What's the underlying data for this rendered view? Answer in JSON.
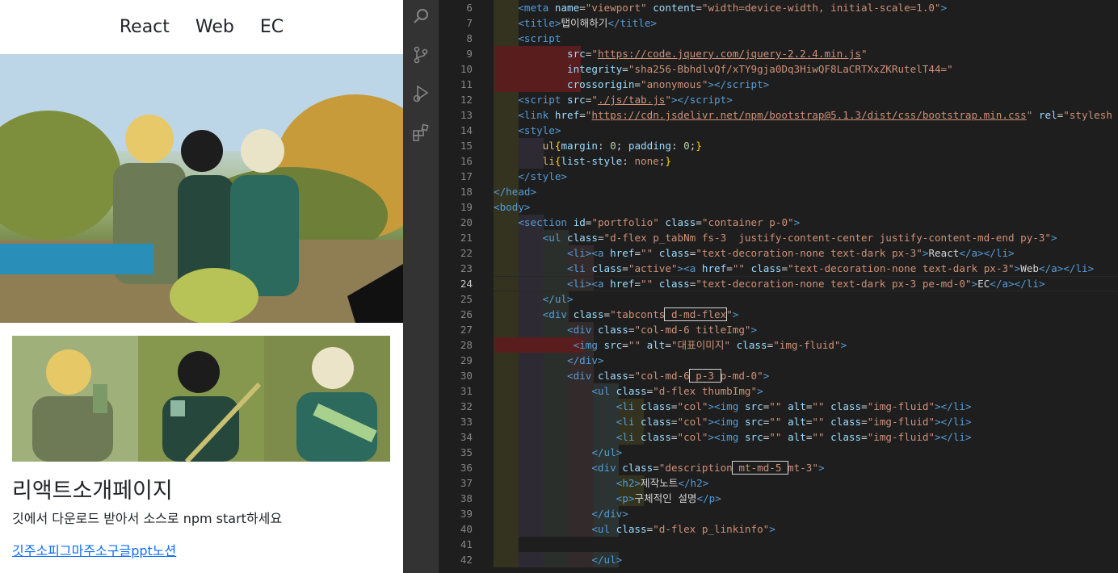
{
  "preview": {
    "tabs": [
      "React",
      "Web",
      "EC"
    ],
    "title": "리액트소개페이지",
    "text": "깃에서 다운로드 받아서 소스로 npm start하세요",
    "links": "깃주소피그마주소구글ppt노션"
  },
  "activity_icons": [
    "search-icon",
    "source-control-icon",
    "run-debug-icon",
    "extensions-icon"
  ],
  "editor": {
    "lines": [
      {
        "n": "6",
        "html": "<span class='t'>&lt;meta</span> <span class='a'>name</span>=<span class='s'>\"viewport\"</span> <span class='a'>content</span>=<span class='s'>\"width=device-width, initial-scale=1.0\"</span><span class='t'>&gt;</span>"
      },
      {
        "n": "7",
        "html": "<span class='t'>&lt;title&gt;</span>탭이해하기<span class='t'>&lt;/title&gt;</span>"
      },
      {
        "n": "8",
        "html": "<span class='t'>&lt;script</span>"
      },
      {
        "n": "9",
        "html": "        <span class='a'>src</span>=<span class='s'>\"</span><span class='u'>https://code.jquery.com/jquery-2.2.4.min.js</span><span class='s'>\"</span>"
      },
      {
        "n": "10",
        "html": "        <span class='a'>integrity</span>=<span class='s'>\"sha256-BbhdlvQf/xTY9gja0Dq3HiwQF8LaCRTXxZKRutelT44=\"</span>"
      },
      {
        "n": "11",
        "html": "        <span class='a'>crossorigin</span>=<span class='s'>\"anonymous\"</span><span class='t'>&gt;&lt;/script&gt;</span>"
      },
      {
        "n": "12",
        "html": "<span class='t'>&lt;script</span> <span class='a'>src</span>=<span class='s'>\"</span><span class='u'>./js/tab.js</span><span class='s'>\"</span><span class='t'>&gt;&lt;/script&gt;</span>"
      },
      {
        "n": "13",
        "html": "<span class='t'>&lt;link</span> <span class='a'>href</span>=<span class='s'>\"</span><span class='u'>https://cdn.jsdelivr.net/npm/bootstrap@5.1.3/dist/css/bootstrap.min.css</span><span class='s'>\"</span> <span class='a'>rel</span>=<span class='s'>\"stylesh</span>"
      },
      {
        "n": "14",
        "html": "<span class='t'>&lt;style&gt;</span>"
      },
      {
        "n": "15",
        "html": "    <span class='y'>ul</span><span class='b'>{</span><span class='k'>margin</span>: <span style='color:#b5cea8'>0</span>; <span class='k'>padding</span>: <span style='color:#b5cea8'>0</span>;<span class='b'>}</span>"
      },
      {
        "n": "16",
        "html": "    <span class='y'>li</span><span class='b'>{</span><span class='k'>list-style</span>: <span class='s'>none</span>;<span class='b'>}</span>"
      },
      {
        "n": "17",
        "html": "<span class='t'>&lt;/style&gt;</span>"
      },
      {
        "n": "18",
        "html": "<span class='t'>&lt;/head&gt;</span>"
      },
      {
        "n": "19",
        "html": "<span class='t'>&lt;body&gt;</span>"
      },
      {
        "n": "20",
        "html": "    <span class='t'>&lt;section</span> <span class='a'>id</span>=<span class='s'>\"portfolio\"</span> <span class='a'>class</span>=<span class='s'>\"container p-0\"</span><span class='t'>&gt;</span>"
      },
      {
        "n": "21",
        "html": "        <span class='t'>&lt;ul</span> <span class='a'>class</span>=<span class='s'>\"d-flex p_tabNm fs-3  justify-content-center justify-content-md-end py-3\"</span><span class='t'>&gt;</span>"
      },
      {
        "n": "22",
        "html": "            <span class='t'>&lt;li&gt;&lt;a</span> <span class='a'>href</span>=<span class='s'>\"\"</span> <span class='a'>class</span>=<span class='s'>\"text-decoration-none text-dark px-3\"</span><span class='t'>&gt;</span>React<span class='t'>&lt;/a&gt;&lt;/li&gt;</span>"
      },
      {
        "n": "23",
        "html": "            <span class='t'>&lt;li</span> <span class='a'>class</span>=<span class='s'>\"active\"</span><span class='t'>&gt;&lt;a</span> <span class='a'>href</span>=<span class='s'>\"\"</span> <span class='a'>class</span>=<span class='s'>\"text-decoration-none text-dark px-3\"</span><span class='t'>&gt;</span>Web<span class='t'>&lt;/a&gt;&lt;/li&gt;</span>"
      },
      {
        "n": "24",
        "html": "            <span class='t'>&lt;li&gt;&lt;a</span> <span class='a'>href</span>=<span class='s'>\"\"</span> <span class='a'>class</span>=<span class='s'>\"text-decoration-none text-dark px-3 pe-md-0\"</span><span class='t'>&gt;</span>EC<span class='t'>&lt;/a&gt;&lt;/li&gt;</span>"
      },
      {
        "n": "25",
        "html": "        <span class='t'>&lt;/ul&gt;</span>"
      },
      {
        "n": "26",
        "html": "        <span class='t'>&lt;div</span> <span class='a'>class</span>=<span class='s'>\"tabconts<span class='box'> d-md-flex</span>\"</span><span class='t'>&gt;</span>"
      },
      {
        "n": "27",
        "html": "            <span class='t'>&lt;div</span> <span class='a'>class</span>=<span class='s'>\"col-md-6 titleImg\"</span><span class='t'>&gt;</span>"
      },
      {
        "n": "28",
        "html": "             <span class='t'>&lt;img</span> <span class='a'>src</span>=<span class='s'>\"\"</span> <span class='a'>alt</span>=<span class='s'>\"대표이미지\"</span> <span class='a'>class</span>=<span class='s'>\"img-fluid\"</span><span class='t'>&gt;</span>"
      },
      {
        "n": "29",
        "html": "            <span class='t'>&lt;/div&gt;</span>"
      },
      {
        "n": "30",
        "html": "            <span class='t'>&lt;div</span> <span class='a'>class</span>=<span class='s'>\"col-md-6<span class='box'> p-3 </span>p-md-0\"</span><span class='t'>&gt;</span>"
      },
      {
        "n": "31",
        "html": "                <span class='t'>&lt;ul</span> <span class='a'>class</span>=<span class='s'>\"d-flex thumbImg\"</span><span class='t'>&gt;</span>"
      },
      {
        "n": "32",
        "html": "                    <span class='t'>&lt;li</span> <span class='a'>class</span>=<span class='s'>\"col\"</span><span class='t'>&gt;&lt;img</span> <span class='a'>src</span>=<span class='s'>\"\"</span> <span class='a'>alt</span>=<span class='s'>\"\"</span> <span class='a'>class</span>=<span class='s'>\"img-fluid\"</span><span class='t'>&gt;&lt;/li&gt;</span>"
      },
      {
        "n": "33",
        "html": "                    <span class='t'>&lt;li</span> <span class='a'>class</span>=<span class='s'>\"col\"</span><span class='t'>&gt;&lt;img</span> <span class='a'>src</span>=<span class='s'>\"\"</span> <span class='a'>alt</span>=<span class='s'>\"\"</span> <span class='a'>class</span>=<span class='s'>\"img-fluid\"</span><span class='t'>&gt;&lt;/li&gt;</span>"
      },
      {
        "n": "34",
        "html": "                    <span class='t'>&lt;li</span> <span class='a'>class</span>=<span class='s'>\"col\"</span><span class='t'>&gt;&lt;img</span> <span class='a'>src</span>=<span class='s'>\"\"</span> <span class='a'>alt</span>=<span class='s'>\"\"</span> <span class='a'>class</span>=<span class='s'>\"img-fluid\"</span><span class='t'>&gt;&lt;/li&gt;</span>"
      },
      {
        "n": "35",
        "html": "                <span class='t'>&lt;/ul&gt;</span>"
      },
      {
        "n": "36",
        "html": "                <span class='t'>&lt;div</span> <span class='a'>class</span>=<span class='s'>\"description<span class='box'> mt-md-5 </span>mt-3\"</span><span class='t'>&gt;</span>"
      },
      {
        "n": "37",
        "html": "                    <span class='t'>&lt;h2&gt;</span>제작노트<span class='t'>&lt;/h2&gt;</span>"
      },
      {
        "n": "38",
        "html": "                    <span class='t'>&lt;p&gt;</span>구체적인 설명<span class='t'>&lt;/p&gt;</span>"
      },
      {
        "n": "39",
        "html": "                <span class='t'>&lt;/div&gt;</span>"
      },
      {
        "n": "40",
        "html": "                <span class='t'>&lt;ul</span> <span class='a'>class</span>=<span class='s'>\"d-flex p_linkinfo\"</span><span class='t'>&gt;</span>"
      },
      {
        "n": "41",
        "html": ""
      },
      {
        "n": "42",
        "html": "                <span class='t'>&lt;/ul&gt;</span>"
      }
    ]
  }
}
